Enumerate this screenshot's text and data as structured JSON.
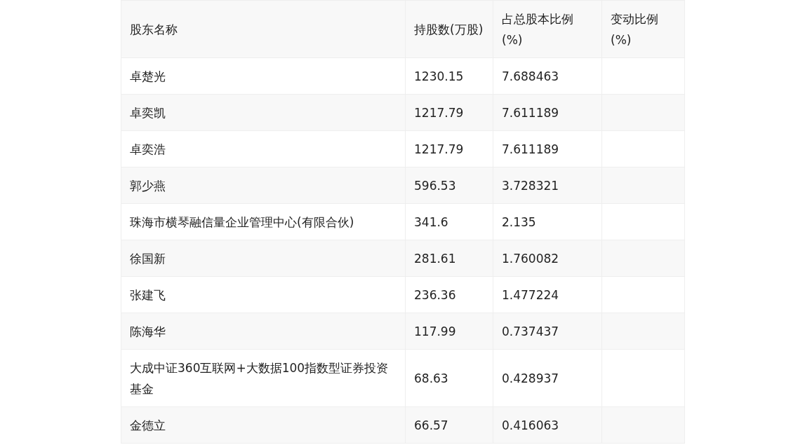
{
  "table": {
    "columns": [
      "股东名称",
      "持股数(万股)",
      "占总股本比例(%)",
      "变动比例(%)"
    ],
    "rows": [
      {
        "name": "卓楚光",
        "shares": "1230.15",
        "ratio": "7.688463"
      },
      {
        "name": "卓奕凯",
        "shares": "1217.79",
        "ratio": "7.611189"
      },
      {
        "name": "卓奕浩",
        "shares": "1217.79",
        "ratio": "7.611189"
      },
      {
        "name": "郭少燕",
        "shares": "596.53",
        "ratio": "3.728321"
      },
      {
        "name": "珠海市横琴融信量企业管理中心(有限合伙)",
        "shares": "341.6",
        "ratio": "2.135"
      },
      {
        "name": "徐国新",
        "shares": "281.61",
        "ratio": "1.760082"
      },
      {
        "name": "张建飞",
        "shares": "236.36",
        "ratio": "1.477224"
      },
      {
        "name": "陈海华",
        "shares": "117.99",
        "ratio": "0.737437"
      },
      {
        "name": "大成中证360互联网+大数据100指数型证券投资基金",
        "shares": "68.63",
        "ratio": "0.428937"
      },
      {
        "name": "金德立",
        "shares": "66.57",
        "ratio": "0.416063"
      }
    ]
  }
}
